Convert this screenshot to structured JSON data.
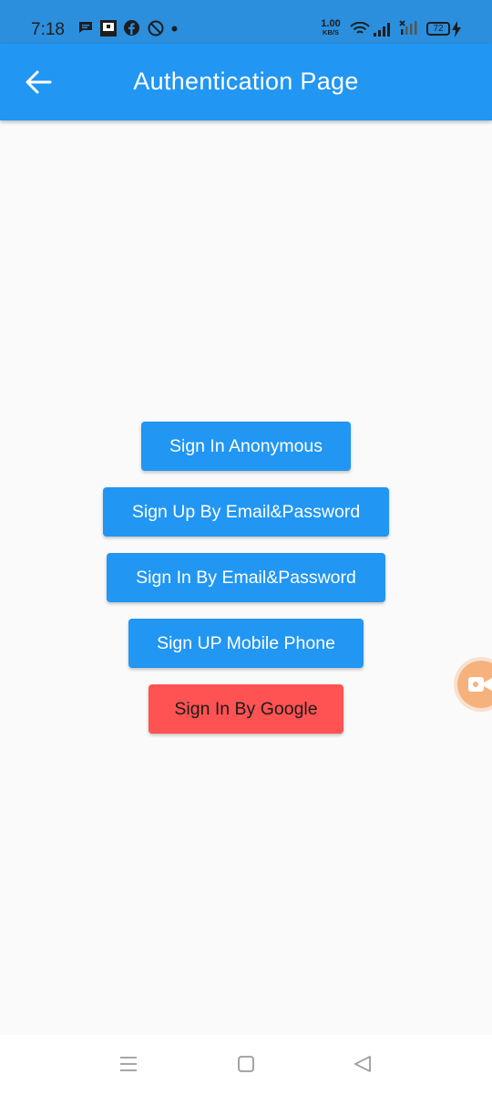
{
  "status_bar": {
    "time": "7:18",
    "net_speed_value": "1.00",
    "net_speed_unit": "KB/S",
    "battery": "72",
    "icons": [
      "message-icon",
      "screen-icon",
      "facebook-icon",
      "blocked-icon",
      "dot-icon",
      "wifi-icon",
      "signal-icon",
      "signal-x-icon",
      "battery-icon",
      "charging-icon"
    ]
  },
  "app_bar": {
    "back_icon": "arrow-left-icon",
    "title": "Authentication Page",
    "color": "#2196f3"
  },
  "buttons": {
    "anonymous": "Sign In Anonymous",
    "signup_email": "Sign Up By Email&Password",
    "signin_email": "Sign In By Email&Password",
    "mobile": "Sign UP Mobile Phone",
    "google": "Sign In By Google"
  },
  "colors": {
    "primary": "#2196f3",
    "google": "#ff5252",
    "background": "#fafafa"
  },
  "floating": {
    "icon": "video-camera-icon"
  },
  "nav_bar": {
    "icons": [
      "menu-icon",
      "home-icon",
      "back-icon"
    ]
  }
}
